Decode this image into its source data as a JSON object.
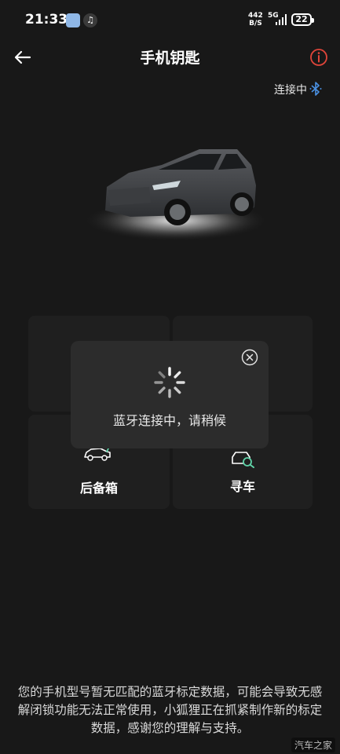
{
  "status_bar": {
    "time": "21:33",
    "net_speed_value": "442",
    "net_speed_unit": "B/S",
    "network_type": "5G",
    "battery": "22"
  },
  "header": {
    "title": "手机钥匙"
  },
  "connection": {
    "status": "连接中"
  },
  "tiles": {
    "trunk_label": "后备箱",
    "find_car_label": "寻车"
  },
  "toast": {
    "message": "蓝牙连接中，请稍候"
  },
  "notice": "您的手机型号暂无匹配的蓝牙标定数据，可能会导致无感解闭锁功能无法正常使用，小狐狸正在抓紧制作新的标定数据，感谢您的理解与支持。",
  "watermark": "汽车之家",
  "colors": {
    "background": "#181818",
    "tile": "#1f1f1f",
    "toast": "#2c2c2c",
    "info_accent": "#e0453a",
    "bluetooth_accent": "#4a90e2"
  }
}
